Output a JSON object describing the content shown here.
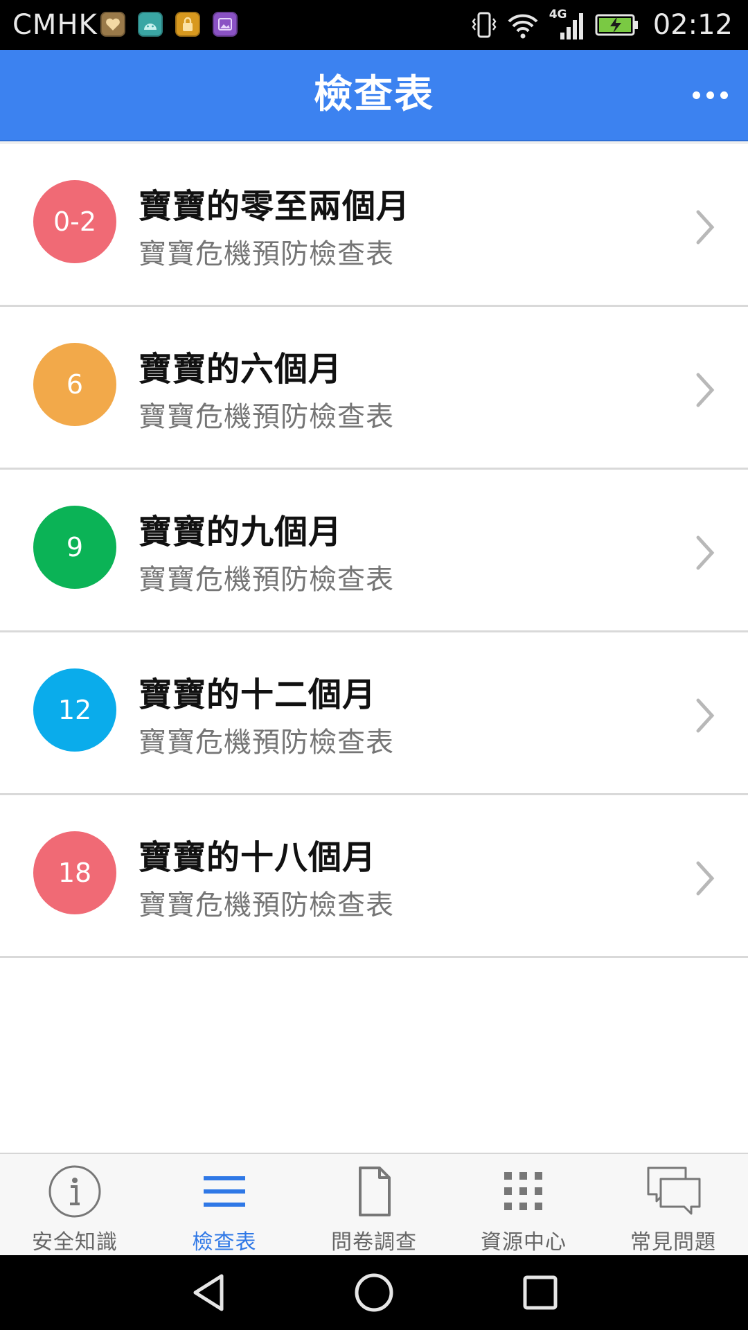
{
  "status_bar": {
    "carrier": "CMHK",
    "network": "4G",
    "time": "02:12"
  },
  "app_bar": {
    "title": "檢查表"
  },
  "list": {
    "items": [
      {
        "badge": "0-2",
        "badge_color": "#f06a75",
        "title": "寶寶的零至兩個月",
        "subtitle": "寶寶危機預防檢查表"
      },
      {
        "badge": "6",
        "badge_color": "#f2a94a",
        "title": "寶寶的六個月",
        "subtitle": "寶寶危機預防檢查表"
      },
      {
        "badge": "9",
        "badge_color": "#0bb356",
        "title": "寶寶的九個月",
        "subtitle": "寶寶危機預防檢查表"
      },
      {
        "badge": "12",
        "badge_color": "#0aaceb",
        "title": "寶寶的十二個月",
        "subtitle": "寶寶危機預防檢查表"
      },
      {
        "badge": "18",
        "badge_color": "#f06a75",
        "title": "寶寶的十八個月",
        "subtitle": "寶寶危機預防檢查表"
      }
    ]
  },
  "tabs": [
    {
      "label": "安全知識",
      "icon": "info-icon"
    },
    {
      "label": "檢查表",
      "icon": "list-icon",
      "active": true
    },
    {
      "label": "問卷調查",
      "icon": "document-icon"
    },
    {
      "label": "資源中心",
      "icon": "grid-icon"
    },
    {
      "label": "常見問題",
      "icon": "chat-icon"
    }
  ],
  "colors": {
    "primary": "#3c82f0",
    "active_tab": "#2f78e6"
  }
}
